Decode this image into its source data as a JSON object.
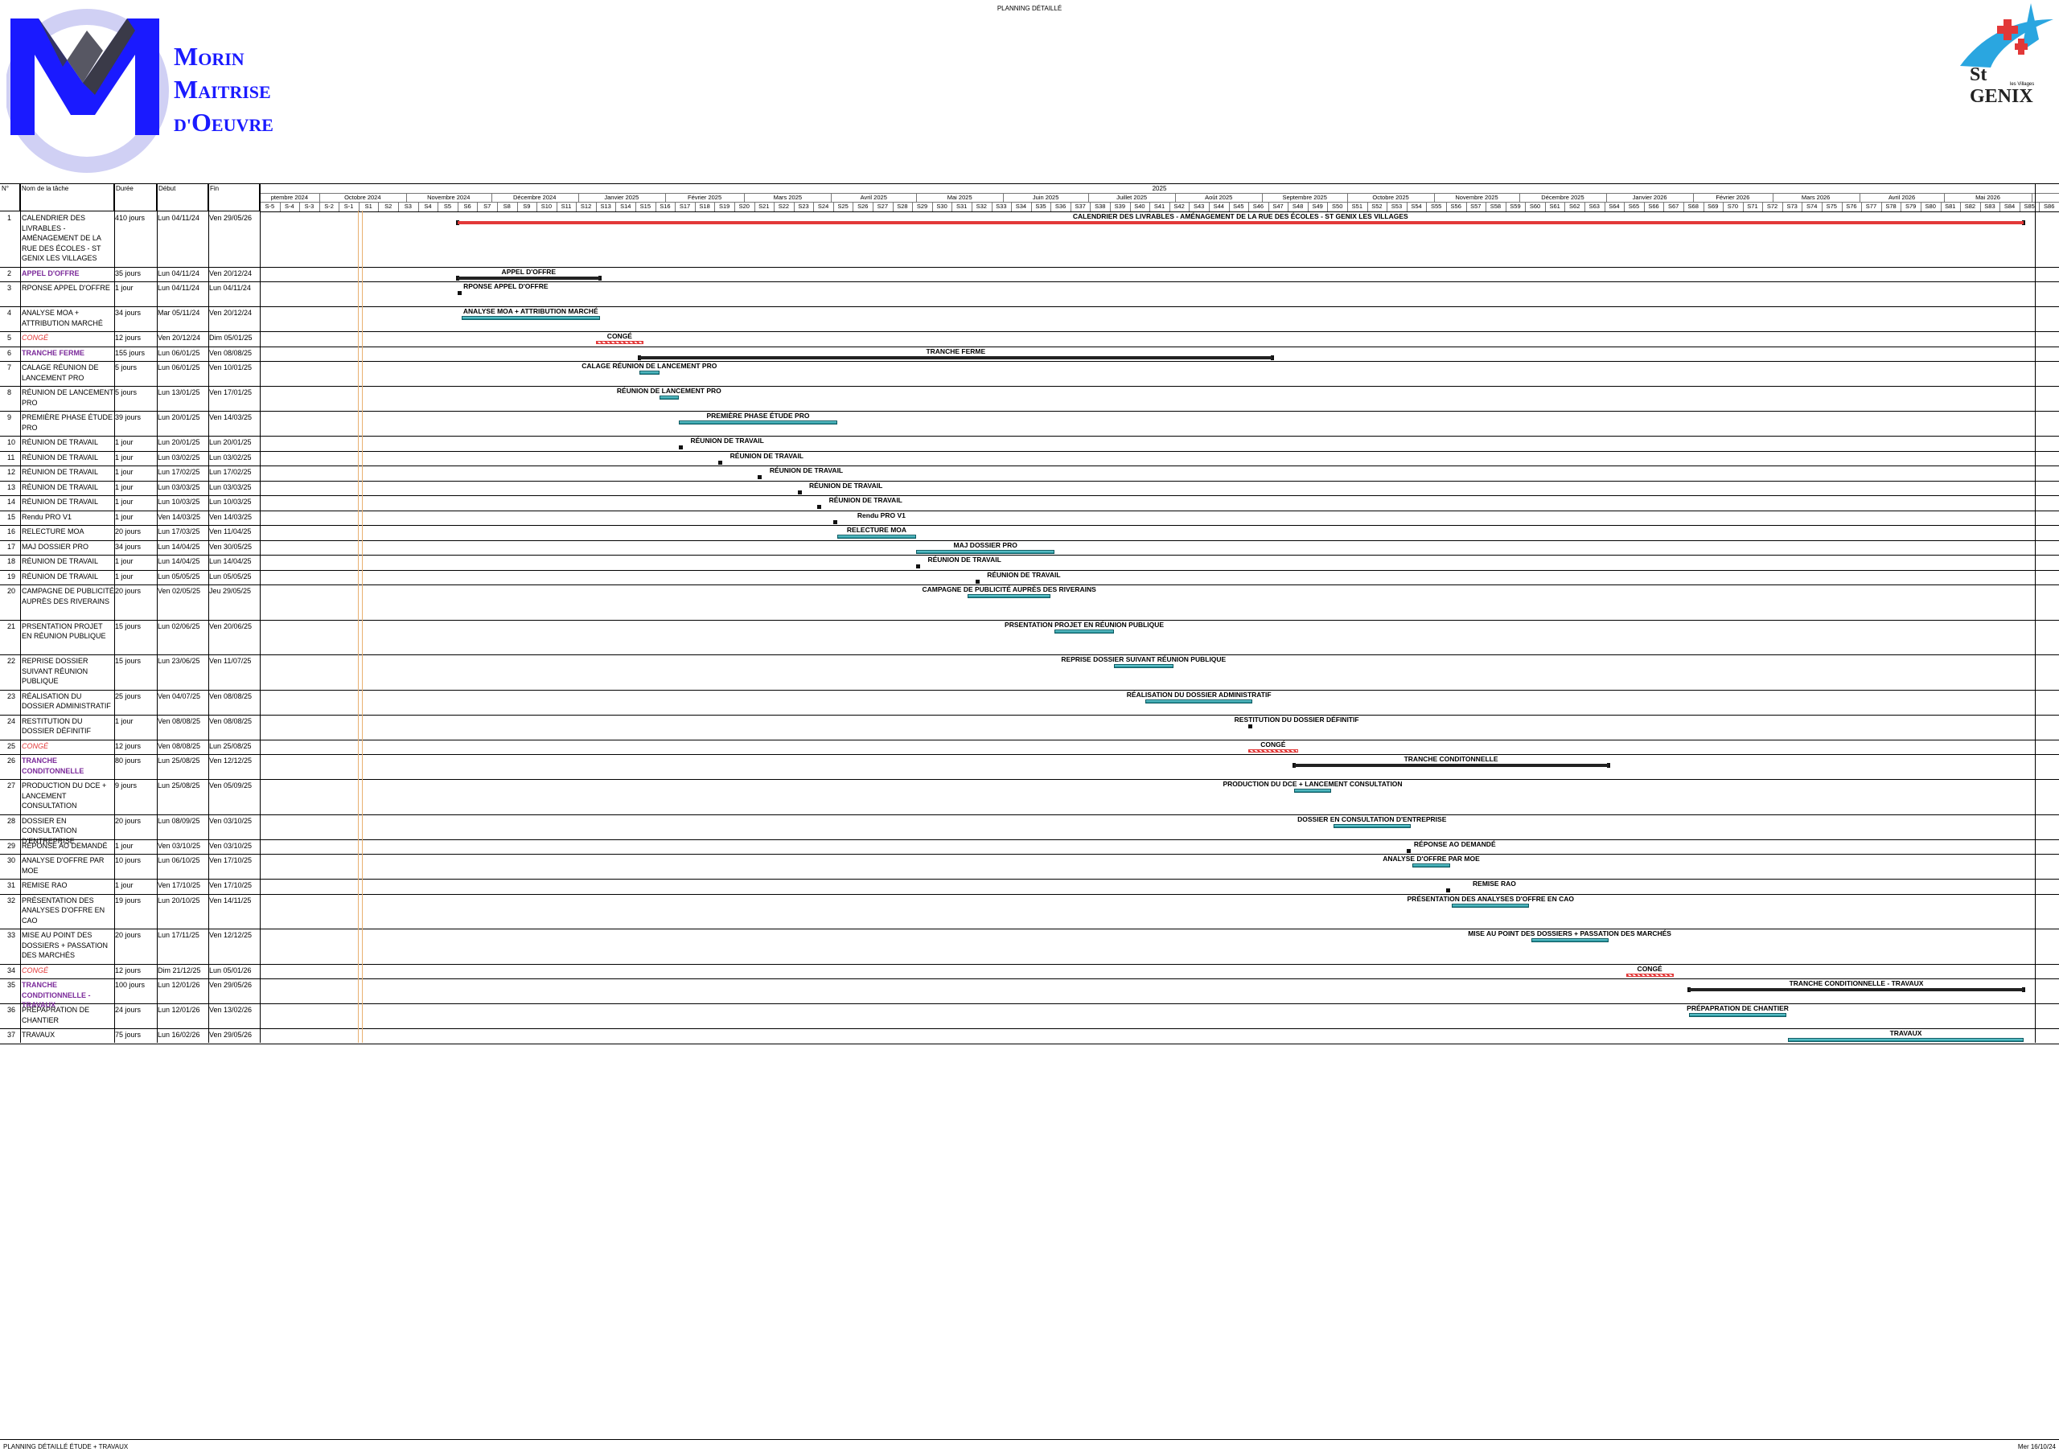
{
  "page": {
    "title": "PLANNING DÉTAILLÉ"
  },
  "logo_left": {
    "lines": [
      "MORIN",
      "MAITRISE",
      "D'OEUVRE"
    ],
    "letters": [
      [
        "M",
        "ORIN"
      ],
      [
        "M",
        "AITRISE"
      ],
      [
        "D'",
        "O",
        "EUVRE"
      ]
    ]
  },
  "logo_right": {
    "text": "St GENIX",
    "sub": "les Villages"
  },
  "columns": {
    "id": "N°",
    "name": "Nom de la tâche",
    "duration": "Durée",
    "start": "Début",
    "end": "Fin"
  },
  "timeline": {
    "year": "2025",
    "months": [
      "ptembre 2024",
      "Octobre 2024",
      "Novembre 2024",
      "Décembre 2024",
      "Janvier 2025",
      "Février 2025",
      "Mars 2025",
      "Avril 2025",
      "Mai 2025",
      "Juin 2025",
      "Juillet 2025",
      "Août 2025",
      "Septembre 2025",
      "Octobre 2025",
      "Novembre 2025",
      "Décembre 2025",
      "Janvier 2026",
      "Février 2026",
      "Mars 2026",
      "Avril 2026",
      "Mai 2026"
    ],
    "weeks": [
      "S-5",
      "S-4",
      "S-3",
      "S-2",
      "S-1",
      "S1",
      "S2",
      "S3",
      "S4",
      "S5",
      "S6",
      "S7",
      "S8",
      "S9",
      "S10",
      "S11",
      "S12",
      "S13",
      "S14",
      "S15",
      "S16",
      "S17",
      "S18",
      "S19",
      "S20",
      "S21",
      "S22",
      "S23",
      "S24",
      "S25",
      "S26",
      "S27",
      "S28",
      "S29",
      "S30",
      "S31",
      "S32",
      "S33",
      "S34",
      "S35",
      "S36",
      "S37",
      "S38",
      "S39",
      "S40",
      "S41",
      "S42",
      "S43",
      "S44",
      "S45",
      "S46",
      "S47",
      "S48",
      "S49",
      "S50",
      "S51",
      "S52",
      "S53",
      "S54",
      "S55",
      "S56",
      "S57",
      "S58",
      "S59",
      "S60",
      "S61",
      "S62",
      "S63",
      "S64",
      "S65",
      "S66",
      "S67",
      "S68",
      "S69",
      "S70",
      "S71",
      "S72",
      "S73",
      "S74",
      "S75",
      "S76",
      "S77",
      "S78",
      "S79",
      "S80",
      "S81",
      "S82",
      "S83",
      "S84",
      "S85",
      "S86"
    ]
  },
  "tasks": [
    {
      "id": "1",
      "name": "CALENDRIER DES LIVRABLES - AMÉNAGEMENT DE LA RUE DES ÉCOLES - ST GENIX LES VILLAGES",
      "duration": "410 jours",
      "start": "Lun 04/11/24",
      "end": "Ven 29/05/26",
      "label": "CALENDRIER DES LIVRABLES - AMÉNAGEMENT DE LA RUE DES ÉCOLES - ST GENIX LES VILLAGES",
      "style": "normal",
      "kind": "summary-red",
      "w0": 6,
      "w1": 85
    },
    {
      "id": "2",
      "name": "APPEL D'OFFRE",
      "duration": "35 jours",
      "start": "Lun 04/11/24",
      "end": "Ven 20/12/24",
      "label": "APPEL D'OFFRE",
      "style": "purple",
      "kind": "summary",
      "w0": 6,
      "w1": 13
    },
    {
      "id": "3",
      "name": "RPONSE APPEL D'OFFRE",
      "duration": "1 jour",
      "start": "Lun 04/11/24",
      "end": "Lun 04/11/24",
      "label": "RPONSE APPEL D'OFFRE",
      "style": "normal",
      "kind": "milestone",
      "w0": 6,
      "w1": 6
    },
    {
      "id": "4",
      "name": "ANALYSE MOA + ATTRIBUTION MARCHÉ",
      "duration": "34 jours",
      "start": "Mar 05/11/24",
      "end": "Ven 20/12/24",
      "label": "ANALYSE MOA + ATTRIBUTION MARCHÉ",
      "style": "normal",
      "kind": "task",
      "w0": 6.2,
      "w1": 13
    },
    {
      "id": "5",
      "name": "CONGÉ",
      "duration": "12 jours",
      "start": "Ven 20/12/24",
      "end": "Dim 05/01/25",
      "label": "CONGÉ",
      "style": "red",
      "kind": "conge",
      "w0": 13,
      "w1": 15.2
    },
    {
      "id": "6",
      "name": "TRANCHE FERME",
      "duration": "155 jours",
      "start": "Lun 06/01/25",
      "end": "Ven 08/08/25",
      "label": "TRANCHE FERME",
      "style": "purple",
      "kind": "summary",
      "w0": 15.2,
      "w1": 47
    },
    {
      "id": "7",
      "name": "CALAGE RÉUNION DE LANCEMENT PRO",
      "duration": "5 jours",
      "start": "Lun 06/01/25",
      "end": "Ven 10/01/25",
      "label": "CALAGE RÉUNION DE LANCEMENT PRO",
      "style": "normal",
      "kind": "task",
      "w0": 15.2,
      "w1": 16
    },
    {
      "id": "8",
      "name": "RÉUNION DE LANCEMENT PRO",
      "duration": "5 jours",
      "start": "Lun 13/01/25",
      "end": "Ven 17/01/25",
      "label": "RÉUNION DE LANCEMENT PRO",
      "style": "normal",
      "kind": "task",
      "w0": 16.2,
      "w1": 17
    },
    {
      "id": "9",
      "name": "PREMIÈRE PHASE ÉTUDE PRO",
      "duration": "39 jours",
      "start": "Lun 20/01/25",
      "end": "Ven 14/03/25",
      "label": "PREMIÈRE PHASE ÉTUDE PRO",
      "style": "normal",
      "kind": "task",
      "w0": 17.2,
      "w1": 25
    },
    {
      "id": "10",
      "name": "RÉUNION DE TRAVAIL",
      "duration": "1 jour",
      "start": "Lun 20/01/25",
      "end": "Lun 20/01/25",
      "label": "RÉUNION DE TRAVAIL",
      "style": "normal",
      "kind": "milestone",
      "w0": 17.2,
      "w1": 17.2
    },
    {
      "id": "11",
      "name": "RÉUNION DE TRAVAIL",
      "duration": "1 jour",
      "start": "Lun 03/02/25",
      "end": "Lun 03/02/25",
      "label": "RÉUNION DE TRAVAIL",
      "style": "normal",
      "kind": "milestone",
      "w0": 19.2,
      "w1": 19.2
    },
    {
      "id": "12",
      "name": "RÉUNION DE TRAVAIL",
      "duration": "1 jour",
      "start": "Lun 17/02/25",
      "end": "Lun 17/02/25",
      "label": "RÉUNION DE TRAVAIL",
      "style": "normal",
      "kind": "milestone",
      "w0": 21.2,
      "w1": 21.2
    },
    {
      "id": "13",
      "name": "RÉUNION DE TRAVAIL",
      "duration": "1 jour",
      "start": "Lun 03/03/25",
      "end": "Lun 03/03/25",
      "label": "RÉUNION DE TRAVAIL",
      "style": "normal",
      "kind": "milestone",
      "w0": 23.2,
      "w1": 23.2
    },
    {
      "id": "14",
      "name": "RÉUNION DE TRAVAIL",
      "duration": "1 jour",
      "start": "Lun 10/03/25",
      "end": "Lun 10/03/25",
      "label": "RÉUNION DE TRAVAIL",
      "style": "normal",
      "kind": "milestone",
      "w0": 24.2,
      "w1": 24.2
    },
    {
      "id": "15",
      "name": "Rendu PRO V1",
      "duration": "1 jour",
      "start": "Ven 14/03/25",
      "end": "Ven 14/03/25",
      "label": "Rendu PRO V1",
      "style": "normal",
      "kind": "milestone",
      "w0": 25,
      "w1": 25
    },
    {
      "id": "16",
      "name": "RELECTURE MOA",
      "duration": "20 jours",
      "start": "Lun 17/03/25",
      "end": "Ven 11/04/25",
      "label": "RELECTURE MOA",
      "style": "normal",
      "kind": "task",
      "w0": 25.2,
      "w1": 29
    },
    {
      "id": "17",
      "name": "MAJ DOSSIER PRO",
      "duration": "34 jours",
      "start": "Lun 14/04/25",
      "end": "Ven 30/05/25",
      "label": "MAJ DOSSIER PRO",
      "style": "normal",
      "kind": "task",
      "w0": 29.2,
      "w1": 36
    },
    {
      "id": "18",
      "name": "RÉUNION DE TRAVAIL",
      "duration": "1 jour",
      "start": "Lun 14/04/25",
      "end": "Lun 14/04/25",
      "label": "RÉUNION DE TRAVAIL",
      "style": "normal",
      "kind": "milestone",
      "w0": 29.2,
      "w1": 29.2
    },
    {
      "id": "19",
      "name": "RÉUNION DE TRAVAIL",
      "duration": "1 jour",
      "start": "Lun 05/05/25",
      "end": "Lun 05/05/25",
      "label": "RÉUNION DE TRAVAIL",
      "style": "normal",
      "kind": "milestone",
      "w0": 32.2,
      "w1": 32.2
    },
    {
      "id": "20",
      "name": "CAMPAGNE DE PUBLICITÉ AUPRÈS DES RIVERAINS",
      "duration": "20 jours",
      "start": "Ven 02/05/25",
      "end": "Jeu 29/05/25",
      "label": "CAMPAGNE DE PUBLICITÉ AUPRÈS DES RIVERAINS",
      "style": "normal",
      "kind": "task",
      "w0": 31.8,
      "w1": 35.8
    },
    {
      "id": "21",
      "name": "PRSENTATION PROJET EN RÉUNION PUBLIQUE",
      "duration": "15 jours",
      "start": "Lun 02/06/25",
      "end": "Ven 20/06/25",
      "label": "PRSENTATION PROJET EN RÉUNION PUBLIQUE",
      "style": "normal",
      "kind": "task",
      "w0": 36.2,
      "w1": 39
    },
    {
      "id": "22",
      "name": "REPRISE DOSSIER SUIVANT RÉUNION PUBLIQUE",
      "duration": "15 jours",
      "start": "Lun 23/06/25",
      "end": "Ven 11/07/25",
      "label": "REPRISE DOSSIER SUIVANT RÉUNION PUBLIQUE",
      "style": "normal",
      "kind": "task",
      "w0": 39.2,
      "w1": 42
    },
    {
      "id": "23",
      "name": "RÉALISATION DU DOSSIER ADMINISTRATIF",
      "duration": "25 jours",
      "start": "Ven 04/07/25",
      "end": "Ven 08/08/25",
      "label": "RÉALISATION DU DOSSIER ADMINISTRATIF",
      "style": "normal",
      "kind": "task",
      "w0": 40.8,
      "w1": 46
    },
    {
      "id": "24",
      "name": "RESTITUTION DU DOSSIER DÉFINITIF",
      "duration": "1 jour",
      "start": "Ven 08/08/25",
      "end": "Ven 08/08/25",
      "label": "RESTITUTION DU DOSSIER DÉFINITIF",
      "style": "normal",
      "kind": "milestone",
      "w0": 46,
      "w1": 46
    },
    {
      "id": "25",
      "name": "CONGÉ",
      "duration": "12 jours",
      "start": "Ven 08/08/25",
      "end": "Lun 25/08/25",
      "label": "CONGÉ",
      "style": "red",
      "kind": "conge",
      "w0": 46,
      "w1": 48.3
    },
    {
      "id": "26",
      "name": "TRANCHE CONDITONNELLE",
      "duration": "80 jours",
      "start": "Lun 25/08/25",
      "end": "Ven 12/12/25",
      "label": "TRANCHE CONDITONNELLE",
      "style": "purple",
      "kind": "summary",
      "w0": 48.3,
      "w1": 64
    },
    {
      "id": "27",
      "name": "PRODUCTION DU DCE + LANCEMENT CONSULTATION",
      "duration": "9 jours",
      "start": "Lun 25/08/25",
      "end": "Ven 05/09/25",
      "label": "PRODUCTION DU DCE + LANCEMENT CONSULTATION",
      "style": "normal",
      "kind": "task",
      "w0": 48.3,
      "w1": 50
    },
    {
      "id": "28",
      "name": "DOSSIER EN CONSULTATION D'ENTREPRISE",
      "duration": "20 jours",
      "start": "Lun 08/09/25",
      "end": "Ven 03/10/25",
      "label": "DOSSIER EN CONSULTATION D'ENTREPRISE",
      "style": "normal",
      "kind": "task",
      "w0": 50.3,
      "w1": 54
    },
    {
      "id": "29",
      "name": "RÉPONSE AO DEMANDÉ",
      "duration": "1 jour",
      "start": "Ven 03/10/25",
      "end": "Ven 03/10/25",
      "label": "RÉPONSE AO DEMANDÉ",
      "style": "normal",
      "kind": "milestone",
      "w0": 54,
      "w1": 54
    },
    {
      "id": "30",
      "name": "ANALYSE D'OFFRE PAR MOE",
      "duration": "10 jours",
      "start": "Lun 06/10/25",
      "end": "Ven 17/10/25",
      "label": "ANALYSE D'OFFRE PAR MOE",
      "style": "normal",
      "kind": "task",
      "w0": 54.3,
      "w1": 56
    },
    {
      "id": "31",
      "name": "REMISE RAO",
      "duration": "1 jour",
      "start": "Ven 17/10/25",
      "end": "Ven 17/10/25",
      "label": "REMISE RAO",
      "style": "normal",
      "kind": "milestone",
      "w0": 56,
      "w1": 56
    },
    {
      "id": "32",
      "name": "PRÉSENTATION DES ANALYSES D'OFFRE EN CAO",
      "duration": "19 jours",
      "start": "Lun 20/10/25",
      "end": "Ven 14/11/25",
      "label": "PRÉSENTATION DES ANALYSES D'OFFRE EN CAO",
      "style": "normal",
      "kind": "task",
      "w0": 56.3,
      "w1": 60
    },
    {
      "id": "33",
      "name": "MISE AU POINT DES DOSSIERS + PASSATION DES MARCHÉS",
      "duration": "20 jours",
      "start": "Lun 17/11/25",
      "end": "Ven 12/12/25",
      "label": "MISE AU POINT DES DOSSIERS + PASSATION DES MARCHÉS",
      "style": "normal",
      "kind": "task",
      "w0": 60.3,
      "w1": 64
    },
    {
      "id": "34",
      "name": "CONGÉ",
      "duration": "12 jours",
      "start": "Dim 21/12/25",
      "end": "Lun 05/01/26",
      "label": "CONGÉ",
      "style": "red",
      "kind": "conge",
      "w0": 65.1,
      "w1": 67.3
    },
    {
      "id": "35",
      "name": "TRANCHE CONDITIONNELLE - TRAVAUX",
      "duration": "100 jours",
      "start": "Lun 12/01/26",
      "end": "Ven 29/05/26",
      "label": "TRANCHE CONDITIONNELLE - TRAVAUX",
      "style": "purple",
      "kind": "summary",
      "w0": 68.3,
      "w1": 85
    },
    {
      "id": "36",
      "name": "PRÉPAPRATION DE CHANTIER",
      "duration": "24 jours",
      "start": "Lun 12/01/26",
      "end": "Ven 13/02/26",
      "label": "PRÉPAPRATION DE CHANTIER",
      "style": "normal",
      "kind": "task",
      "w0": 68.3,
      "w1": 73
    },
    {
      "id": "37",
      "name": "TRAVAUX",
      "duration": "75 jours",
      "start": "Lun 16/02/26",
      "end": "Ven 29/05/26",
      "label": "TRAVAUX",
      "style": "normal",
      "kind": "task",
      "w0": 73.3,
      "w1": 85
    }
  ],
  "footer": {
    "left": "PLANNING DÉTAILLÉ ÉTUDE + TRAVAUX",
    "right": "Mer 16/10/24"
  },
  "colors": {
    "bar_task": "#2aa0a8",
    "summary": "#222222",
    "conge": "#e23838",
    "purple": "#7b2a9a"
  }
}
